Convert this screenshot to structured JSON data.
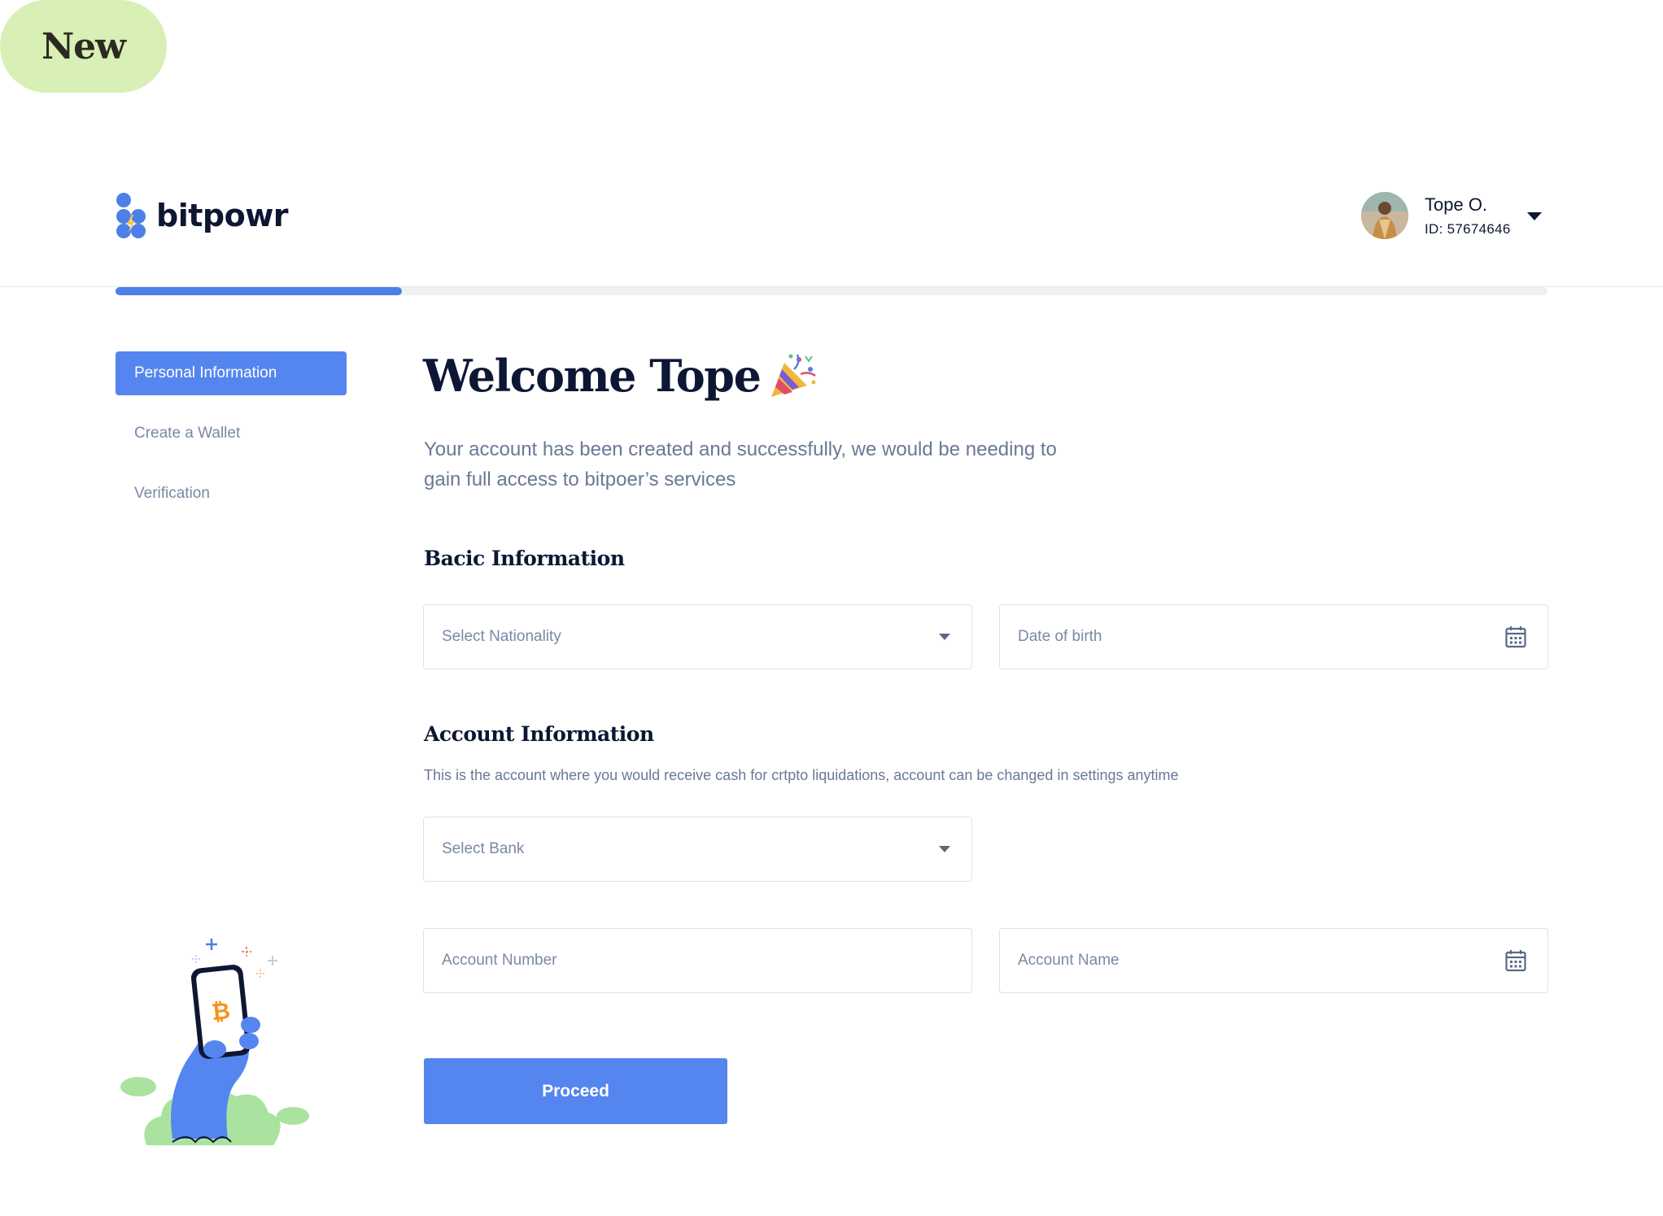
{
  "badge": {
    "label": "New"
  },
  "brand": {
    "name": "bitpowr"
  },
  "user": {
    "name": "Tope O.",
    "id_label": "ID: 57674646"
  },
  "progress": {
    "fraction": 0.2
  },
  "sidebar": {
    "items": [
      {
        "label": "Personal Information",
        "active": true
      },
      {
        "label": "Create a Wallet",
        "active": false
      },
      {
        "label": "Verification",
        "active": false
      }
    ]
  },
  "main": {
    "welcome": "Welcome Tope",
    "welcome_emoji": "party-popper-icon",
    "intro_line1": "Your account has been created and successfully, we would be needing to",
    "intro_line2": "gain full access to bitpoer’s services",
    "basic": {
      "title": "Bacic Information",
      "nationality_placeholder": "Select Nationality",
      "dob_placeholder": "Date of birth"
    },
    "account": {
      "title": "Account Information",
      "helper": "This is the account where you would receive cash for crtpto liquidations, account can be changed in settings anytime",
      "bank_placeholder": "Select Bank",
      "number_placeholder": "Account Number",
      "name_placeholder": "Account Name"
    },
    "proceed_label": "Proceed"
  },
  "colors": {
    "accent": "#5585ef",
    "badge_bg": "#d8f0b6",
    "text_dark": "#0d1733",
    "text_muted": "#6a7896"
  }
}
